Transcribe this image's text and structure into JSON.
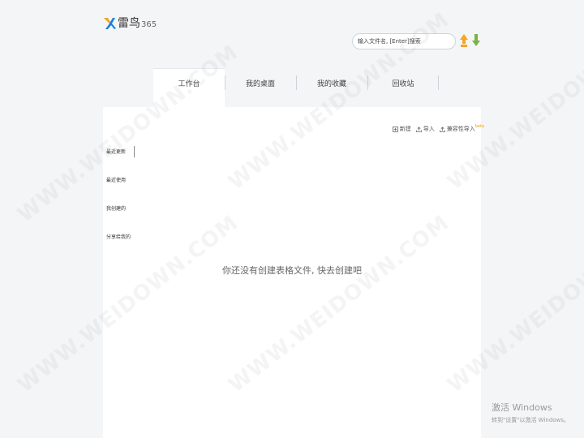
{
  "app": {
    "name": "雷鸟",
    "version": "365"
  },
  "search": {
    "placeholder": "输入文件名, [Enter]搜索"
  },
  "nav": {
    "tabs": [
      {
        "label": "工作台",
        "active": true
      },
      {
        "label": "我的桌面"
      },
      {
        "label": "我的收藏"
      },
      {
        "label": "回收站"
      }
    ]
  },
  "toolbar": {
    "new_label": "新建",
    "import_label": "导入",
    "compat_import_label": "兼容性导入",
    "beta_label": "beta"
  },
  "side_menu": {
    "items": [
      {
        "label": "最近更新",
        "active": true
      },
      {
        "label": "最近使用"
      },
      {
        "label": "我创建的"
      },
      {
        "label": "分享给我的"
      }
    ]
  },
  "main": {
    "empty_message": "你还没有创建表格文件, 快去创建吧"
  },
  "watermark": {
    "text": "WWW.WEIDOWN.COM"
  },
  "windows_activation": {
    "title": "激活 Windows",
    "subtitle": "转到\"设置\"以激活 Windows。"
  },
  "colors": {
    "logo_blue": "#1e7fd6",
    "logo_orange": "#f5a623",
    "sync_up": "#f5a623",
    "sync_down": "#7cb342",
    "beta": "#f0a000"
  }
}
